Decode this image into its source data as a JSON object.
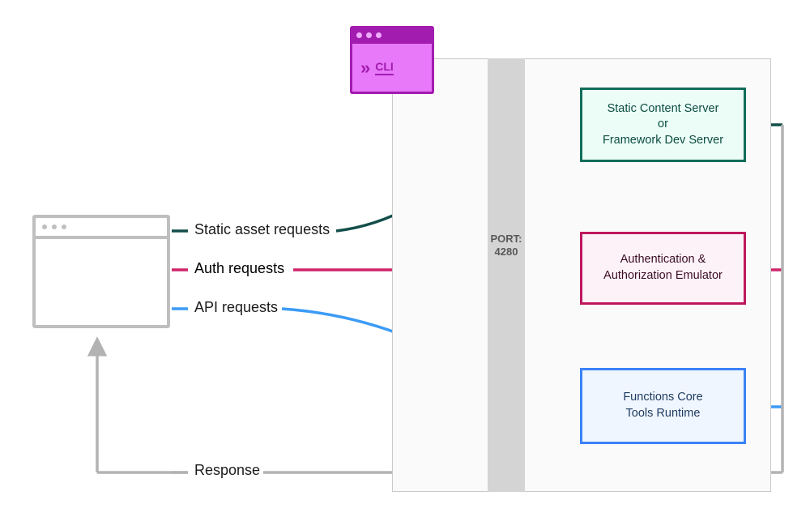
{
  "cli": {
    "label": "CLI"
  },
  "port": {
    "label": "PORT:",
    "value": "4280"
  },
  "flows": {
    "static": {
      "label": "Static asset requests",
      "color": "#134e4a"
    },
    "auth": {
      "label": "Auth requests",
      "color": "#be185d"
    },
    "api": {
      "label": "API requests",
      "color": "#3b82f6"
    },
    "response": {
      "label": "Response",
      "color": "#b3b3b3"
    }
  },
  "services": {
    "static": {
      "line1": "Static Content Server",
      "line2": "or",
      "line3": "Framework  Dev  Server"
    },
    "auth": {
      "line1": "Authentication &",
      "line2": "Authorization Emulator"
    },
    "functions": {
      "line1": "Functions Core",
      "line2": "Tools Runtime"
    }
  },
  "colors": {
    "teal": "#134e4a",
    "pink": "#be185d",
    "blue": "#3b82f6",
    "gray": "#b3b3b3",
    "magenta": "#a21caf"
  }
}
